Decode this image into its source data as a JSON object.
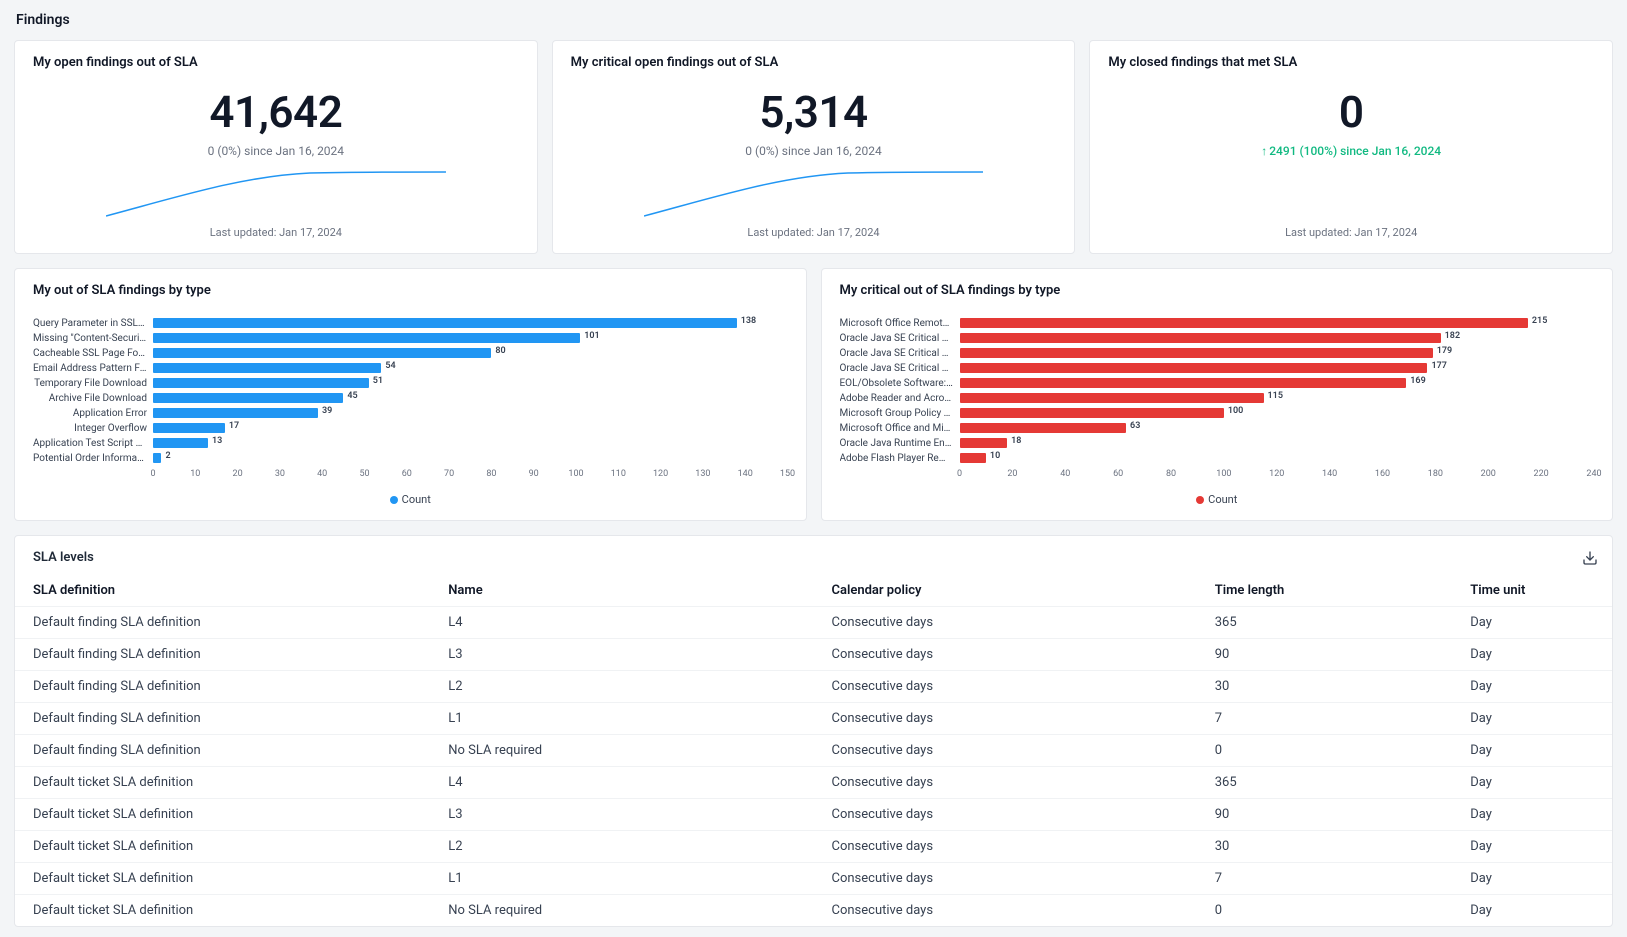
{
  "page_title": "Findings",
  "kpi_cards": [
    {
      "title": "My open findings out of SLA",
      "value": "41,642",
      "delta_prefix": "",
      "delta_text": "0 (0%) since Jan 16, 2024",
      "delta_green": false,
      "last_updated": "Last updated: Jan 17, 2024"
    },
    {
      "title": "My critical open findings out of SLA",
      "value": "5,314",
      "delta_prefix": "",
      "delta_text": "0 (0%) since Jan 16, 2024",
      "delta_green": false,
      "last_updated": "Last updated: Jan 17, 2024"
    },
    {
      "title": "My closed findings that met SLA",
      "value": "0",
      "delta_prefix": "↑ ",
      "delta_text": "2491 (100%) since Jan 16, 2024",
      "delta_green": true,
      "last_updated": "Last updated: Jan 17, 2024"
    }
  ],
  "barcharts": [
    {
      "title": "My out of SLA findings by type",
      "color": "blue",
      "legend": "Count"
    },
    {
      "title": "My critical out of SLA findings by type",
      "color": "red",
      "legend": "Count"
    }
  ],
  "table": {
    "title": "SLA levels",
    "headers": [
      "SLA definition",
      "Name",
      "Calendar policy",
      "Time length",
      "Time unit"
    ],
    "rows": [
      [
        "Default finding SLA definition",
        "L4",
        "Consecutive days",
        "365",
        "Day"
      ],
      [
        "Default finding SLA definition",
        "L3",
        "Consecutive days",
        "90",
        "Day"
      ],
      [
        "Default finding SLA definition",
        "L2",
        "Consecutive days",
        "30",
        "Day"
      ],
      [
        "Default finding SLA definition",
        "L1",
        "Consecutive days",
        "7",
        "Day"
      ],
      [
        "Default finding SLA definition",
        "No SLA required",
        "Consecutive days",
        "0",
        "Day"
      ],
      [
        "Default ticket SLA definition",
        "L4",
        "Consecutive days",
        "365",
        "Day"
      ],
      [
        "Default ticket SLA definition",
        "L3",
        "Consecutive days",
        "90",
        "Day"
      ],
      [
        "Default ticket SLA definition",
        "L2",
        "Consecutive days",
        "30",
        "Day"
      ],
      [
        "Default ticket SLA definition",
        "L1",
        "Consecutive days",
        "7",
        "Day"
      ],
      [
        "Default ticket SLA definition",
        "No SLA required",
        "Consecutive days",
        "0",
        "Day"
      ]
    ]
  },
  "chart_data": [
    {
      "type": "bar",
      "orientation": "horizontal",
      "title": "My out of SLA findings by type",
      "xlabel": "",
      "ylabel": "",
      "xlim": [
        0,
        150
      ],
      "xticks": [
        0,
        10,
        20,
        30,
        40,
        50,
        60,
        70,
        80,
        90,
        100,
        110,
        120,
        130,
        140,
        150
      ],
      "series_name": "Count",
      "categories": [
        "Query Parameter in SSL R...",
        "Missing \"Content-Security...",
        "Cacheable SSL Page Found",
        "Email Address Pattern Fou...",
        "Temporary File Download",
        "Archive File Download",
        "Application Error",
        "Integer Overflow",
        "Application Test Script Det...",
        "Potential Order Informatio..."
      ],
      "values": [
        138,
        101,
        80,
        54,
        51,
        45,
        39,
        17,
        13,
        2
      ]
    },
    {
      "type": "bar",
      "orientation": "horizontal",
      "title": "My critical out of SLA findings by type",
      "xlabel": "",
      "ylabel": "",
      "xlim": [
        0,
        240
      ],
      "xticks": [
        0,
        20,
        40,
        60,
        80,
        100,
        120,
        140,
        160,
        180,
        200,
        220,
        240
      ],
      "series_name": "Count",
      "categories": [
        "Microsoft Office Remote C...",
        "Oracle Java SE Critical Pat...",
        "Oracle Java SE Critical Pat...",
        "Oracle Java SE Critical Pat...",
        "EOL/Obsolete Software: O...",
        "Adobe Reader and Acroba...",
        "Microsoft Group Policy Re...",
        "Microsoft Office and Micro...",
        "Oracle Java Runtime Envir...",
        "Adobe Flash Player Remot..."
      ],
      "values": [
        215,
        182,
        179,
        177,
        169,
        115,
        100,
        63,
        18,
        10
      ]
    }
  ]
}
